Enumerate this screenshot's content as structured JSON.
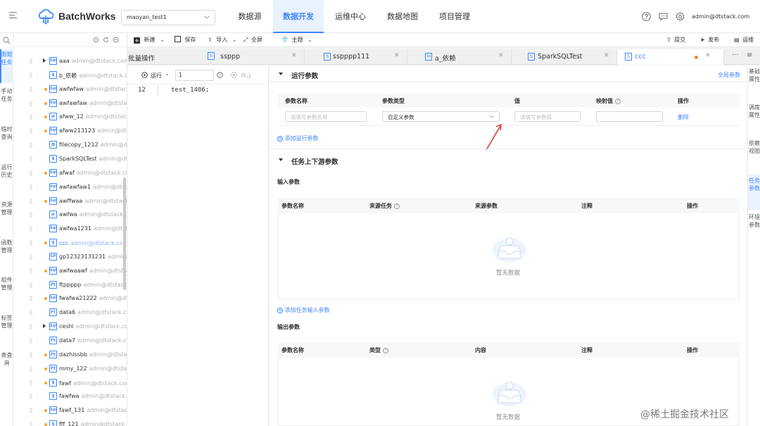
{
  "app": {
    "name": "BatchWorks"
  },
  "header": {
    "project": "maoyan_test1",
    "nav": [
      "数据源",
      "数据开发",
      "运维中心",
      "数据地图",
      "项目管理"
    ],
    "active_nav": "数据开发",
    "user": "admin@dtstack.com"
  },
  "left_nav": [
    "周期任务",
    "手动任务",
    "临时查询",
    "运行历史",
    "资源管理",
    "函数管理",
    "组件管理",
    "标签管理",
    "表查询"
  ],
  "tree": {
    "items": [
      {
        "name": "aaa",
        "owner": "admin@dtstack.com",
        "icon": "Sql",
        "arrow": true,
        "dot": false
      },
      {
        "name": "b_依赖",
        "owner": "admin@dtstack.com",
        "icon": "S",
        "arrow": false,
        "dot": false
      },
      {
        "name": "awfwfaw",
        "owner": "admin@dtstack.c",
        "icon": "Sql",
        "arrow": false,
        "dot": true
      },
      {
        "name": "awfawfaw",
        "owner": "admin@dtstack.c",
        "icon": "Sql",
        "arrow": false,
        "dot": true
      },
      {
        "name": "afww_12",
        "owner": "admin@dtstack.c",
        "icon": "wf",
        "arrow": false,
        "dot": true
      },
      {
        "name": "afww213123",
        "owner": "admin@dtst",
        "icon": "Sql",
        "arrow": false,
        "dot": true
      },
      {
        "name": "filecopy_1212",
        "owner": "admin@dtsta",
        "icon": "fc",
        "arrow": false,
        "dot": false
      },
      {
        "name": "SparkSQLTest",
        "owner": "admin@dtst",
        "icon": "S",
        "arrow": false,
        "dot": false
      },
      {
        "name": "afwaf",
        "owner": "admin@dtstack.com",
        "icon": "Sql",
        "arrow": false,
        "dot": true
      },
      {
        "name": "awfawfaw1",
        "owner": "admin@dtstack.c",
        "icon": "Sql",
        "arrow": false,
        "dot": false
      },
      {
        "name": "awffwaa",
        "owner": "admin@dtstack.c",
        "icon": "Sql",
        "arrow": false,
        "dot": true
      },
      {
        "name": "awfwa",
        "owner": "admin@dtstack.com",
        "icon": "wf",
        "arrow": false,
        "dot": false
      },
      {
        "name": "awfwa1231",
        "owner": "admin@dtstack.c",
        "icon": "Sql",
        "arrow": false,
        "dot": false
      },
      {
        "name": "ccc",
        "owner": "admin@dtstack.com 锁",
        "icon": "S",
        "arrow": false,
        "dot": true,
        "selected": true
      },
      {
        "name": "gp12323131231",
        "owner": "admin@dts",
        "icon": "GP",
        "arrow": false,
        "dot": false
      },
      {
        "name": "awfwaawf",
        "owner": "admin@dtstack.c",
        "icon": "Sql",
        "arrow": false,
        "dot": true
      },
      {
        "name": "ftppppp",
        "owner": "admin@dtstack.com",
        "icon": "ft",
        "arrow": false,
        "dot": false
      },
      {
        "name": "fwafwa21222",
        "owner": "admin@dtst",
        "icon": "Sql",
        "arrow": false,
        "dot": true
      },
      {
        "name": "data6",
        "owner": "admin@dtstack.com",
        "icon": "ft",
        "arrow": false,
        "dot": false
      },
      {
        "name": "ceshi",
        "owner": "admin@dtstack.com",
        "icon": "Sql",
        "arrow": true,
        "dot": false
      },
      {
        "name": "data7",
        "owner": "admin@dtstack.com",
        "icon": "ft",
        "arrow": false,
        "dot": false
      },
      {
        "name": "dazhissbb",
        "owner": "admin@dtstack.",
        "icon": "ft",
        "arrow": false,
        "dot": true
      },
      {
        "name": "mmy_122",
        "owner": "admin@dtstack.c",
        "icon": "ft",
        "arrow": false,
        "dot": true
      },
      {
        "name": "fawf",
        "owner": "admin@dtstack.com 锁",
        "icon": "S",
        "arrow": false,
        "dot": true
      },
      {
        "name": "fawfwa",
        "owner": "admin@dtstack.com",
        "icon": "S",
        "arrow": false,
        "dot": false
      },
      {
        "name": "fawf_131",
        "owner": "admin@dtstack.c",
        "icon": "Sql",
        "arrow": false,
        "dot": true
      },
      {
        "name": "fff_121",
        "owner": "admin@dtstack",
        "icon": "S",
        "arrow": false,
        "dot": true
      }
    ]
  },
  "toolbar": {
    "new": "新建",
    "save": "保存",
    "import": "导入",
    "fullscreen": "全屏",
    "theme": "主题",
    "submit": "提交",
    "publish": "发布",
    "ops": "运维"
  },
  "tabs": [
    {
      "label": "批量操作",
      "icon": ""
    },
    {
      "label": "ssppp",
      "icon": "S"
    },
    {
      "label": "sspppp111",
      "icon": "S"
    },
    {
      "label": "a_依赖",
      "icon": "Sql"
    },
    {
      "label": "SparkSQLTest",
      "icon": "S"
    },
    {
      "label": "ccc",
      "icon": "S",
      "active": true
    }
  ],
  "editor": {
    "run_label": "运行",
    "run_count": "1",
    "stop_label": "停止",
    "line_no": "12",
    "code": "test_1406;"
  },
  "run_params": {
    "title": "运行参数",
    "global_link": "全局参数",
    "headers": [
      "参数名称",
      "参数类型",
      "值",
      "映射值",
      "操作"
    ],
    "name_placeholder": "请填写参数名称",
    "type_value": "自定义参数",
    "value_placeholder": "请填写参数值",
    "delete_label": "删除",
    "add_label": "添加运行参数"
  },
  "upstream": {
    "title": "任务上下游参数",
    "input_title": "输入参数",
    "input_headers": [
      "参数名称",
      "来源任务",
      "来源参数",
      "注释",
      "操作"
    ],
    "empty": "暂无数据",
    "add_input": "添加任务输入参数",
    "output_title": "输出参数",
    "output_headers": [
      "参数名称",
      "类型",
      "内容",
      "注释",
      "操作"
    ]
  },
  "right_tabs": [
    "基础属性",
    "调度属性",
    "依赖视图",
    "任务参数",
    "环境参数"
  ],
  "watermark": "@稀土掘金技术社区"
}
